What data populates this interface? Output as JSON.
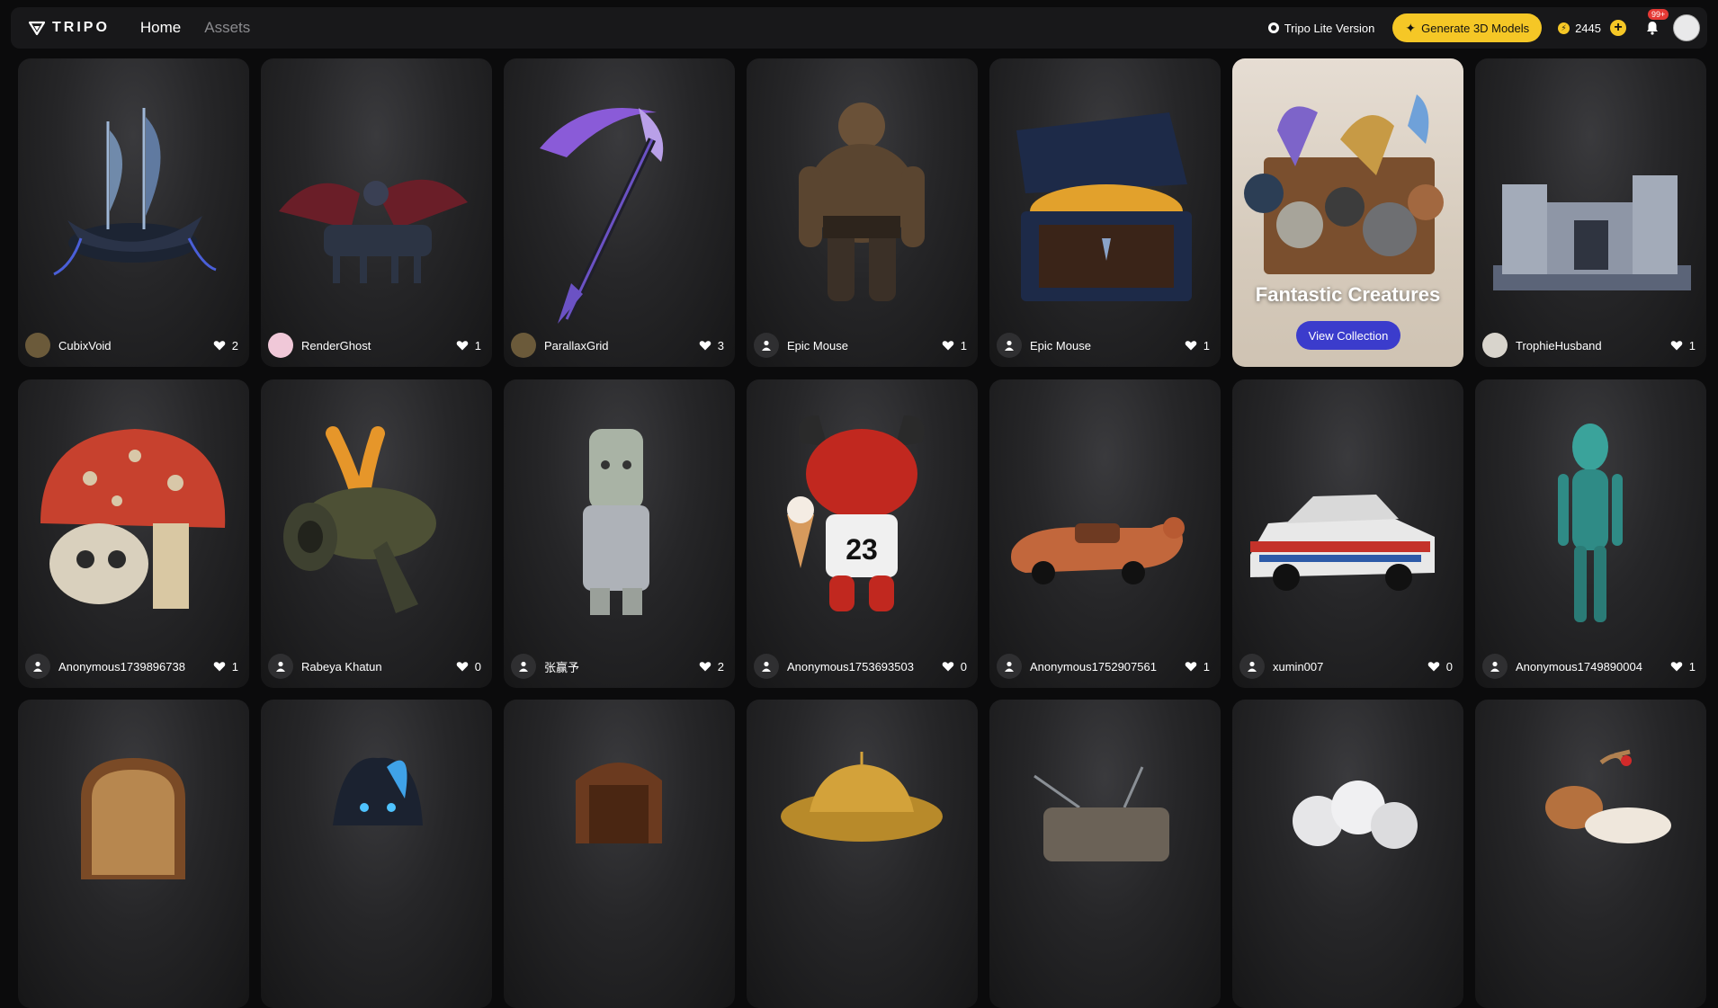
{
  "header": {
    "logo_text": "TRIPO",
    "nav": [
      {
        "label": "Home",
        "active": true
      },
      {
        "label": "Assets",
        "active": false
      }
    ],
    "lite_version_label": "Tripo Lite Version",
    "generate_button_label": "Generate 3D Models",
    "credits": "2445",
    "notification_badge": "99+",
    "accent_color": "#f5c726"
  },
  "collection": {
    "title": "Fantastic Creatures",
    "button_label": "View Collection"
  },
  "cards": [
    {
      "user": "CubixVoid",
      "likes": "2",
      "subject": "ghost-pirate-ship",
      "avatar": "photo"
    },
    {
      "user": "RenderGhost",
      "likes": "1",
      "subject": "winged-chariot",
      "avatar": "photo"
    },
    {
      "user": "ParallaxGrid",
      "likes": "3",
      "subject": "crystal-scythe",
      "avatar": "photo"
    },
    {
      "user": "Epic Mouse",
      "likes": "1",
      "subject": "ogre-warrior",
      "avatar": "default"
    },
    {
      "user": "Epic Mouse",
      "likes": "1",
      "subject": "treasure-chest",
      "avatar": "default"
    },
    {
      "user": "TrophieHusband",
      "likes": "1",
      "subject": "stone-castle",
      "avatar": "photo"
    },
    {
      "user": "Anonymous1739896738",
      "likes": "1",
      "subject": "mushroom-skull",
      "avatar": "default"
    },
    {
      "user": "Rabeya Khatun",
      "likes": "0",
      "subject": "stone-cannon",
      "avatar": "default"
    },
    {
      "user": "张赢予",
      "likes": "2",
      "subject": "jade-statue",
      "avatar": "default"
    },
    {
      "user": "Anonymous1753693503",
      "likes": "0",
      "subject": "red-devil-mascot",
      "avatar": "default"
    },
    {
      "user": "Anonymous1752907561",
      "likes": "1",
      "subject": "sausage-car",
      "avatar": "default"
    },
    {
      "user": "xumin007",
      "likes": "0",
      "subject": "rally-car",
      "avatar": "default"
    },
    {
      "user": "Anonymous1749890004",
      "likes": "1",
      "subject": "alien-figure",
      "avatar": "default"
    },
    {
      "user": "",
      "likes": "",
      "subject": "wicker-chair",
      "avatar": "none"
    },
    {
      "user": "",
      "likes": "",
      "subject": "blue-flame-hood",
      "avatar": "none"
    },
    {
      "user": "",
      "likes": "",
      "subject": "carved-throne",
      "avatar": "none"
    },
    {
      "user": "",
      "likes": "",
      "subject": "golden-ufo",
      "avatar": "none"
    },
    {
      "user": "",
      "likes": "",
      "subject": "retro-tv",
      "avatar": "none"
    },
    {
      "user": "",
      "likes": "",
      "subject": "white-flowers",
      "avatar": "none"
    },
    {
      "user": "",
      "likes": "",
      "subject": "toy-reindeer",
      "avatar": "none"
    }
  ]
}
